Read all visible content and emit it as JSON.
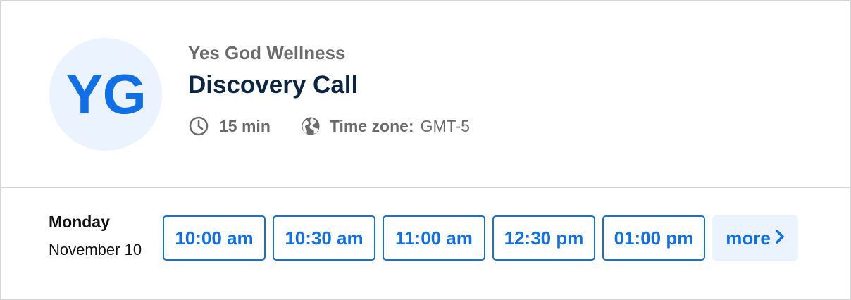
{
  "profile": {
    "initials": "YG",
    "organization": "Yes God Wellness"
  },
  "event": {
    "title": "Discovery Call",
    "duration": "15 min",
    "timezone_label": "Time zone:",
    "timezone_value": "GMT-5"
  },
  "icons": {
    "duration": "clock-icon",
    "timezone": "globe-icon",
    "more": "chevron-right-icon"
  },
  "schedule": {
    "weekday": "Monday",
    "date": "November 10",
    "slots": [
      "10:00 am",
      "10:30 am",
      "11:00 am",
      "12:30 pm",
      "01:00 pm"
    ],
    "more_label": "more"
  },
  "colors": {
    "accent": "#0f6fe6",
    "accent_light": "#ebf3fe",
    "title": "#0c2540",
    "muted": "#6b6b6b"
  }
}
